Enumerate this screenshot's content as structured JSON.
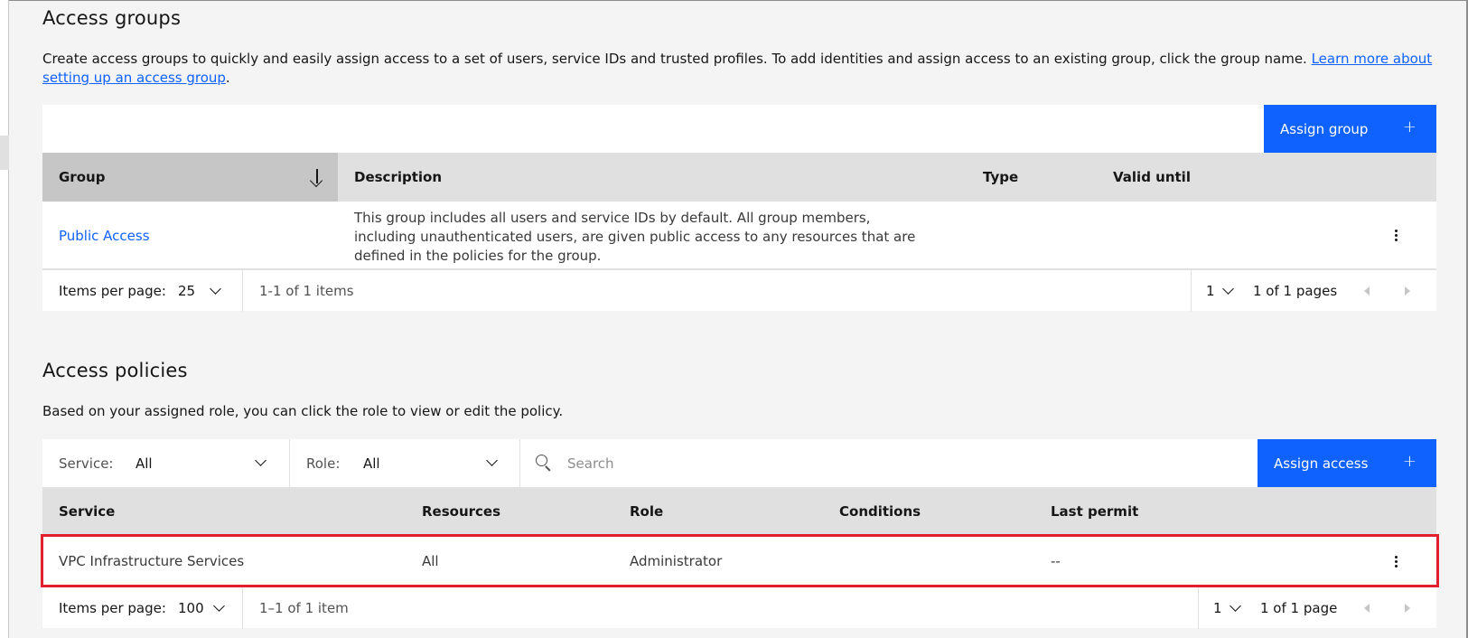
{
  "access_groups": {
    "title": "Access groups",
    "description": "Create access groups to quickly and easily assign access to a set of users, service IDs and trusted profiles. To add identities and assign access to an existing group, click the group name. ",
    "learn_more_link": "Learn more about setting up an access group",
    "description_end": ".",
    "assign_button": "Assign group",
    "columns": {
      "group": "Group",
      "description": "Description",
      "type": "Type",
      "valid_until": "Valid until"
    },
    "rows": [
      {
        "group": "Public Access",
        "description": "This group includes all users and service IDs by default. All group members, including unauthenticated users, are given public access to any resources that are defined in the policies for the group.",
        "type": "",
        "valid_until": ""
      }
    ],
    "pagination": {
      "items_per_page_label": "Items per page:",
      "items_per_page": "25",
      "range": "1-1 of 1 items",
      "page": "1",
      "pages": "1 of 1 pages"
    }
  },
  "access_policies": {
    "title": "Access policies",
    "description": "Based on your assigned role, you can click the role to view or edit the policy.",
    "filters": {
      "service_label": "Service:",
      "service_value": "All",
      "role_label": "Role:",
      "role_value": "All",
      "search_placeholder": "Search"
    },
    "assign_button": "Assign access",
    "columns": {
      "service": "Service",
      "resources": "Resources",
      "role": "Role",
      "conditions": "Conditions",
      "last_permit": "Last permit"
    },
    "rows": [
      {
        "service": "VPC Infrastructure Services",
        "resources": "All",
        "role": "Administrator",
        "conditions": "",
        "last_permit": "--"
      }
    ],
    "pagination": {
      "items_per_page_label": "Items per page:",
      "items_per_page": "100",
      "range": "1–1 of 1 item",
      "page": "1",
      "pages": "1 of 1 page"
    }
  },
  "colors": {
    "primary": "#0f62fe",
    "highlight": "#e21f2c",
    "header_bg": "#e0e0e0"
  },
  "icons": [
    "sort-descending-icon",
    "overflow-menu-icon",
    "chevron-down-icon",
    "search-icon",
    "add-icon",
    "caret-left-icon",
    "caret-right-icon"
  ]
}
